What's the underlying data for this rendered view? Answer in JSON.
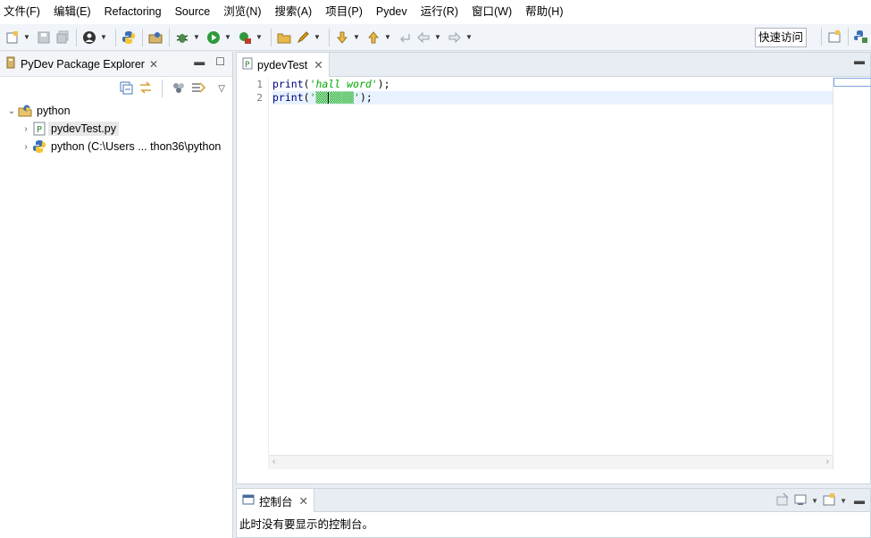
{
  "menu": [
    "文件(F)",
    "编辑(E)",
    "Refactoring",
    "Source",
    "浏览(N)",
    "搜索(A)",
    "项目(P)",
    "Pydev",
    "运行(R)",
    "窗口(W)",
    "帮助(H)"
  ],
  "toolbar": {
    "quick_access": "快速访问"
  },
  "explorer": {
    "tab_label": "PyDev Package Explorer",
    "tree": [
      {
        "label": "python",
        "level": 0,
        "expanded": true,
        "icon": "project-icon"
      },
      {
        "label": "pydevTest.py",
        "level": 1,
        "selected": true,
        "icon": "python-file-icon"
      },
      {
        "label": "python  (C:\\Users ... thon36\\python",
        "level": 1,
        "icon": "python-interpreter-icon"
      }
    ]
  },
  "editor": {
    "tab_label": "pydevTest",
    "line_numbers": [
      "1",
      "2"
    ],
    "lines": [
      {
        "fn": "print",
        "open": "(",
        "str": "'hall word'",
        "close": ");"
      },
      {
        "fn": "print",
        "open": "(",
        "str_a": "'▒▒",
        "str_b": "▒▒▒▒'",
        "close": ");"
      }
    ]
  },
  "console": {
    "tab_label": "控制台",
    "message": "此时没有要显示的控制台。"
  },
  "colors": {
    "keyword": "#000080",
    "string": "#00aa00",
    "current_line": "#e8f2fe"
  }
}
